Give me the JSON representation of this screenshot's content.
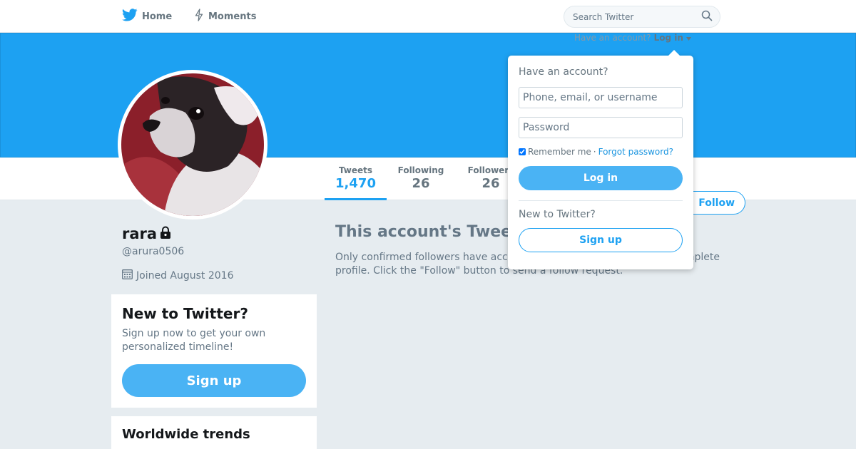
{
  "colors": {
    "brand": "#1da1f2",
    "button": "#4ab3f4",
    "background": "#e6ecf0"
  },
  "nav": {
    "home_label": "Home",
    "moments_label": "Moments",
    "home_icon": "twitter-bird-icon",
    "moments_icon": "lightning-icon"
  },
  "search": {
    "placeholder": "Search Twitter",
    "icon": "search-icon"
  },
  "login_trigger": {
    "prompt": "Have an account?",
    "label": "Log in"
  },
  "profile": {
    "name": "rara",
    "handle": "@arura0506",
    "joined": "Joined August 2016",
    "protected_icon": "lock-icon"
  },
  "stats": [
    {
      "label": "Tweets",
      "value": "1,470"
    },
    {
      "label": "Following",
      "value": "26"
    },
    {
      "label": "Followers",
      "value": "26"
    }
  ],
  "follow_label": "Follow",
  "protected": {
    "title": "This account's Tweets are protected.",
    "text": "Only confirmed followers have access to @arura0506's Tweets and complete profile. Click the \"Follow\" button to send a follow request."
  },
  "signup_card": {
    "title": "New to Twitter?",
    "text": "Sign up now to get your own personalized timeline!",
    "button": "Sign up"
  },
  "trends_card": {
    "title": "Worldwide trends"
  },
  "login_dropdown": {
    "heading": "Have an account?",
    "username_placeholder": "Phone, email, or username",
    "password_placeholder": "Password",
    "remember_label": "Remember me",
    "separator": "·",
    "forgot_label": "Forgot password?",
    "login_button": "Log in",
    "new_heading": "New to Twitter?",
    "signup_button": "Sign up"
  }
}
